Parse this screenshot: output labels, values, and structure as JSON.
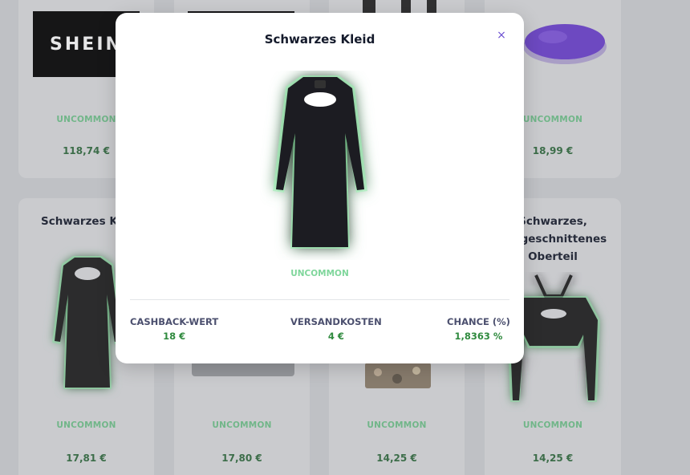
{
  "grid": {
    "row1": [
      {
        "kind": "shein",
        "logo_text": "SHEIN",
        "rarity": "UNCOMMON",
        "price": "118,74 €"
      },
      {
        "kind": "shein",
        "logo_text": "",
        "rarity": "",
        "price": ""
      },
      {
        "kind": "item",
        "rarity": "",
        "price": ""
      },
      {
        "kind": "beret",
        "rarity": "UNCOMMON",
        "price": "18,99 €"
      }
    ],
    "row2": [
      {
        "title": "Schwarzes Kleid",
        "rarity": "UNCOMMON",
        "price": "17,81 €"
      },
      {
        "title": "",
        "rarity": "UNCOMMON",
        "price": "17,80 €"
      },
      {
        "title": "",
        "rarity": "UNCOMMON",
        "price": "14,25 €"
      },
      {
        "title": "Schwarzes, ausgeschnittenes Oberteil",
        "rarity": "UNCOMMON",
        "price": "14,25 €"
      }
    ]
  },
  "modal": {
    "title": "Schwarzes Kleid",
    "close_label": "×",
    "rarity": "UNCOMMON",
    "stats": [
      {
        "label": "CASHBACK-WERT",
        "value": "18 €"
      },
      {
        "label": "VERSANDKOSTEN",
        "value": "4 €"
      },
      {
        "label": "CHANCE (%)",
        "value": "1,8363 %"
      }
    ]
  },
  "colors": {
    "rarity_green": "#6fc48b",
    "price_green": "#2f6b3e",
    "modal_value_green": "#2f8a3e",
    "close_purple": "#6b4fd1",
    "glow_green": "#8df0a8"
  }
}
